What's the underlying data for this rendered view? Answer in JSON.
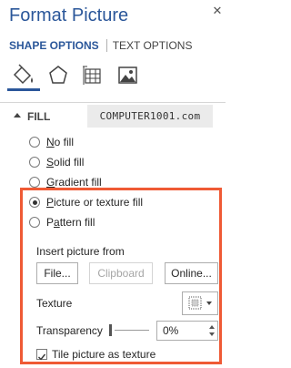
{
  "pane": {
    "title": "Format Picture",
    "close_glyph": "✕"
  },
  "tabs": {
    "active": "SHAPE OPTIONS",
    "inactive": "TEXT OPTIONS"
  },
  "icons": [
    "fill-line-icon",
    "effects-icon",
    "size-properties-icon",
    "picture-icon"
  ],
  "fill_section": {
    "label": "FILL",
    "watermark": "COMPUTER1001.com",
    "options": [
      {
        "label": "No fill",
        "accel": "N",
        "rest": "o fill",
        "selected": false
      },
      {
        "label": "Solid fill",
        "accel": "S",
        "rest": "olid fill",
        "selected": false
      },
      {
        "label": "Gradient fill",
        "accel": "G",
        "rest": "radient fill",
        "selected": false
      },
      {
        "label": "Picture or texture fill",
        "accel": "P",
        "rest": "icture or texture fill",
        "selected": true
      },
      {
        "label": "Pattern fill",
        "accel": "",
        "pre": "P",
        "mid": "a",
        "post": "ttern fill",
        "selected": false
      }
    ],
    "insert_picture_from": "Insert picture from",
    "buttons": {
      "file": "File...",
      "clipboard": "Clipboard",
      "online": "Online..."
    },
    "texture_label": "Texture",
    "transparency_label": "Transparency",
    "transparency_value": "0%",
    "tile_label": "Tile picture as texture",
    "tile_checked": true
  },
  "colors": {
    "accent": "#2b579a",
    "highlight_border": "#ef5a35"
  }
}
